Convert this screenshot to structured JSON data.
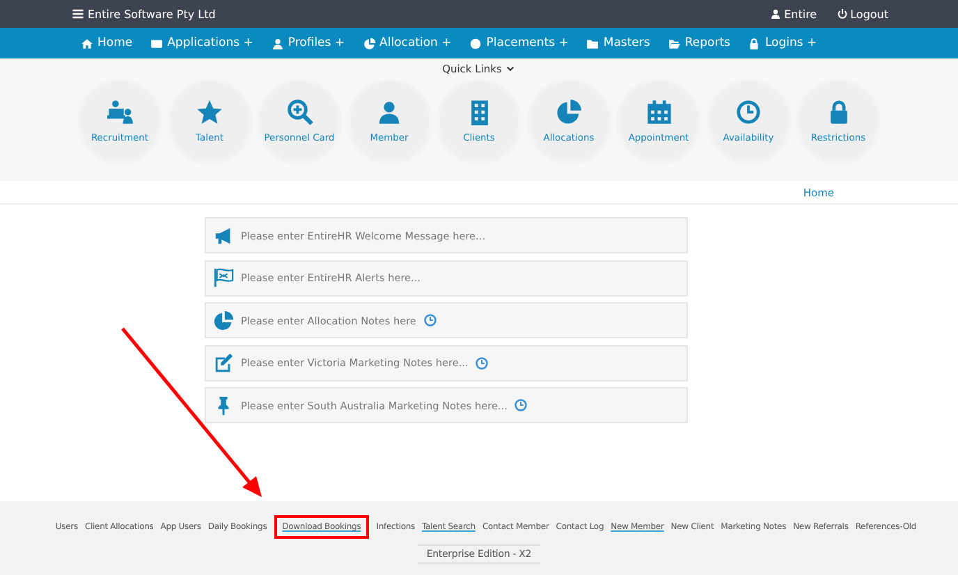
{
  "top_bar": {
    "title": "Entire Software Pty Ltd",
    "user": "Entire",
    "logout": "Logout"
  },
  "nav": [
    "Home",
    "Applications +",
    "Profiles +",
    "Allocation +",
    "Placements +",
    "Masters",
    "Reports",
    "Logins +"
  ],
  "quick_links": {
    "label": "Quick Links",
    "items": [
      "Recruitment",
      "Talent",
      "Personnel Card",
      "Member",
      "Clients",
      "Allocations",
      "Appointment",
      "Availability",
      "Restrictions"
    ]
  },
  "breadcrumb": "Home",
  "notes": [
    {
      "text": "Please enter EntireHR Welcome Message here...",
      "scheduled": false
    },
    {
      "text": "Please enter EntireHR Alerts here...",
      "scheduled": false
    },
    {
      "text": "Please enter Allocation Notes here",
      "scheduled": true
    },
    {
      "text": "Please enter Victoria Marketing Notes here...",
      "scheduled": true
    },
    {
      "text": "Please enter South Australia Marketing Notes here...",
      "scheduled": true
    }
  ],
  "footer": {
    "links": [
      {
        "label": "Users",
        "underlined": false,
        "highlighted": false
      },
      {
        "label": "Client Allocations",
        "underlined": false,
        "highlighted": false
      },
      {
        "label": "App Users",
        "underlined": false,
        "highlighted": false
      },
      {
        "label": "Daily Bookings",
        "underlined": false,
        "highlighted": false
      },
      {
        "label": "Download Bookings",
        "underlined": true,
        "highlighted": true
      },
      {
        "label": "Infections",
        "underlined": false,
        "highlighted": false
      },
      {
        "label": "Talent Search",
        "underlined": true,
        "highlighted": false
      },
      {
        "label": "Contact Member",
        "underlined": false,
        "highlighted": false
      },
      {
        "label": "Contact Log",
        "underlined": false,
        "highlighted": false
      },
      {
        "label": "New Member",
        "underlined": true,
        "highlighted": false
      },
      {
        "label": "New Client",
        "underlined": false,
        "highlighted": false
      },
      {
        "label": "Marketing Notes",
        "underlined": false,
        "highlighted": false
      },
      {
        "label": "New Referrals",
        "underlined": false,
        "highlighted": false
      },
      {
        "label": "References-Old",
        "underlined": false,
        "highlighted": false
      }
    ],
    "edition": "Enterprise Edition - X2"
  }
}
